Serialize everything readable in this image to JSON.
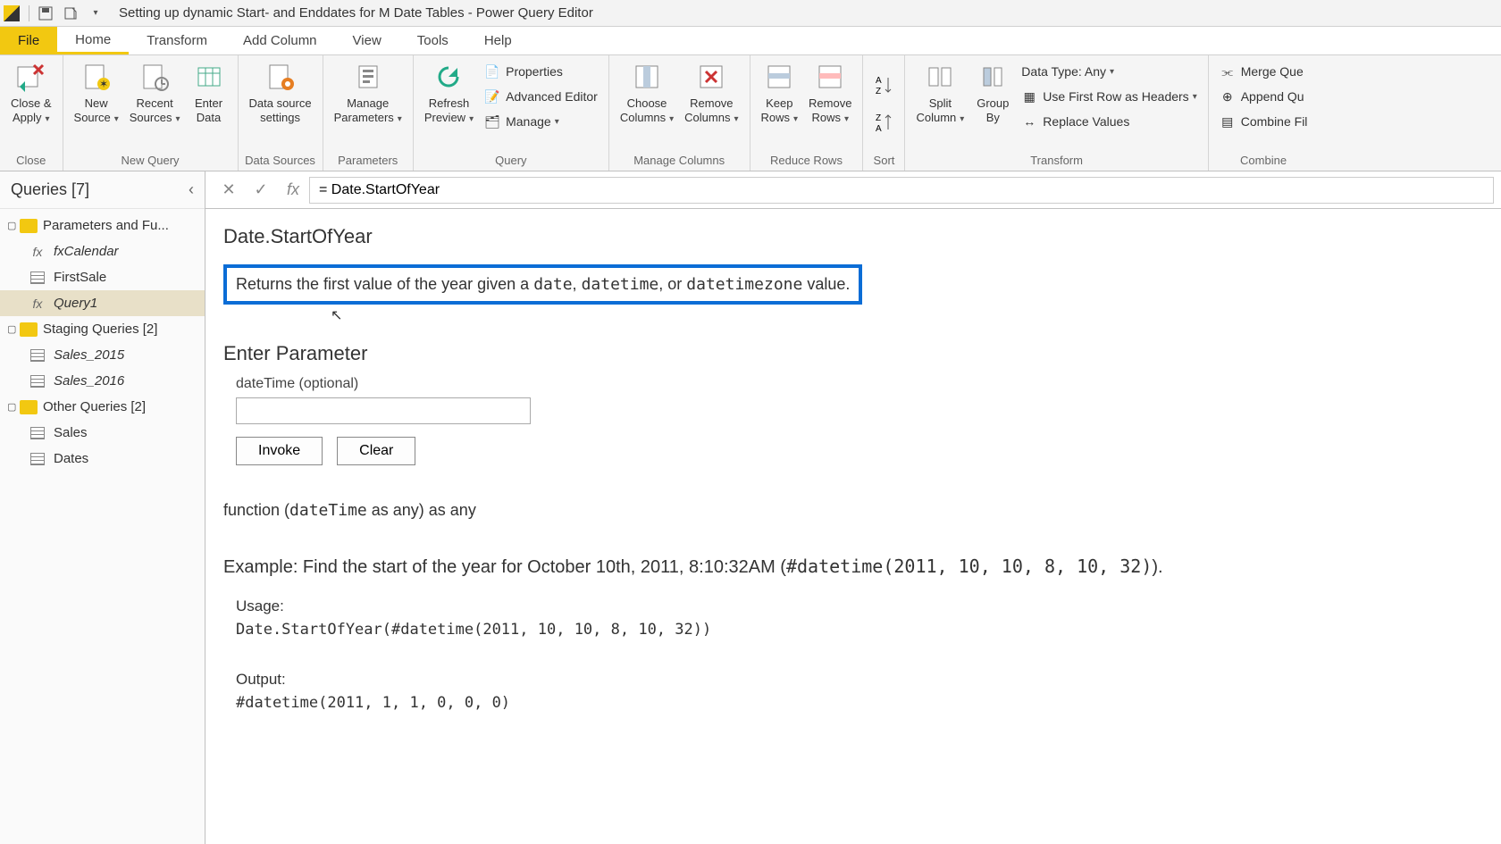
{
  "titlebar": {
    "title": "Setting up dynamic Start- and Enddates for M Date Tables - Power Query Editor"
  },
  "menu": {
    "file": "File",
    "home": "Home",
    "transform": "Transform",
    "addcolumn": "Add Column",
    "view": "View",
    "tools": "Tools",
    "help": "Help"
  },
  "ribbon": {
    "close_apply": "Close &\nApply",
    "close_group": "Close",
    "new_source": "New\nSource",
    "recent_sources": "Recent\nSources",
    "enter_data": "Enter\nData",
    "new_query_group": "New Query",
    "data_source_settings": "Data source\nsettings",
    "data_sources_group": "Data Sources",
    "manage_parameters": "Manage\nParameters",
    "parameters_group": "Parameters",
    "refresh_preview": "Refresh\nPreview",
    "properties": "Properties",
    "advanced_editor": "Advanced Editor",
    "manage": "Manage",
    "query_group": "Query",
    "choose_columns": "Choose\nColumns",
    "remove_columns": "Remove\nColumns",
    "manage_columns_group": "Manage Columns",
    "keep_rows": "Keep\nRows",
    "remove_rows": "Remove\nRows",
    "reduce_rows_group": "Reduce Rows",
    "sort_group": "Sort",
    "split_column": "Split\nColumn",
    "group_by": "Group\nBy",
    "data_type": "Data Type: Any",
    "use_first_row": "Use First Row as Headers",
    "replace_values": "Replace Values",
    "transform_group": "Transform",
    "merge_queries": "Merge Que",
    "append_queries": "Append Qu",
    "combine_files": "Combine Fil",
    "combine_group": "Combine"
  },
  "queries": {
    "header": "Queries [7]",
    "folder1": "Parameters and Fu...",
    "item_fxcalendar": "fxCalendar",
    "item_firstsale": "FirstSale",
    "item_query1": "Query1",
    "folder2": "Staging Queries [2]",
    "item_sales2015": "Sales_2015",
    "item_sales2016": "Sales_2016",
    "folder3": "Other Queries [2]",
    "item_sales": "Sales",
    "item_dates": "Dates"
  },
  "formula": {
    "text": "= Date.StartOfYear"
  },
  "func": {
    "title": "Date.StartOfYear",
    "desc_pre": "Returns the first value of the year given a ",
    "desc_t1": "date",
    "desc_sep1": ", ",
    "desc_t2": "datetime",
    "desc_sep2": ", or ",
    "desc_t3": "datetimezone",
    "desc_post": " value.",
    "enter_parameter": "Enter Parameter",
    "param_label": "dateTime (optional)",
    "invoke": "Invoke",
    "clear": "Clear",
    "sig_pre": "function (",
    "sig_param": "dateTime",
    "sig_post": " as any) as any",
    "example_pre": "Example: Find the start of the year for October 10th, 2011, 8:10:32AM (",
    "example_code": "#datetime(2011, 10, 10, 8, 10, 32)",
    "example_post": ").",
    "usage_label": "Usage:",
    "usage_code": "Date.StartOfYear(#datetime(2011, 10, 10, 8, 10, 32))",
    "output_label": "Output:",
    "output_code": "#datetime(2011, 1, 1, 0, 0, 0)"
  }
}
